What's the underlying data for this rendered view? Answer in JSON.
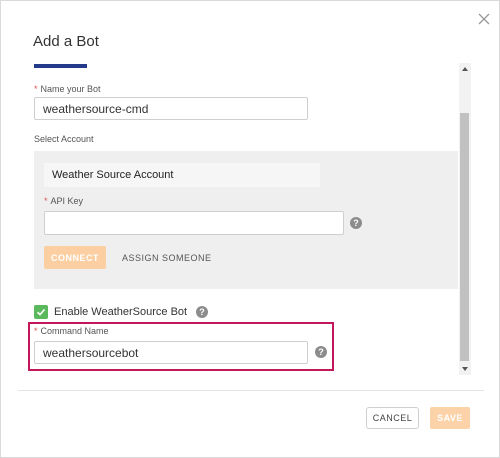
{
  "dialog": {
    "title": "Add a Bot",
    "close_icon": "close-icon",
    "accent_color": "#233b8a"
  },
  "form": {
    "bot_name": {
      "required_mark": "*",
      "label": "Name your Bot",
      "value": "weathersource-cmd"
    },
    "select_account_label": "Select Account",
    "account": {
      "name": "Weather Source Account",
      "api_key": {
        "required_mark": "*",
        "label": "API Key",
        "value": "",
        "help_icon": "question-circle-icon"
      },
      "connect_label": "CONNECT",
      "assign_label": "ASSIGN SOMEONE"
    },
    "enable_bot": {
      "checked": true,
      "label": "Enable WeatherSource Bot",
      "help_icon": "question-circle-icon"
    },
    "command_name": {
      "required_mark": "*",
      "label": "Command Name",
      "value": "weathersourcebot",
      "help_icon": "question-circle-icon",
      "highlight_color": "#c2185b"
    }
  },
  "footer": {
    "cancel_label": "CANCEL",
    "save_label": "SAVE"
  },
  "help_glyph": "?"
}
